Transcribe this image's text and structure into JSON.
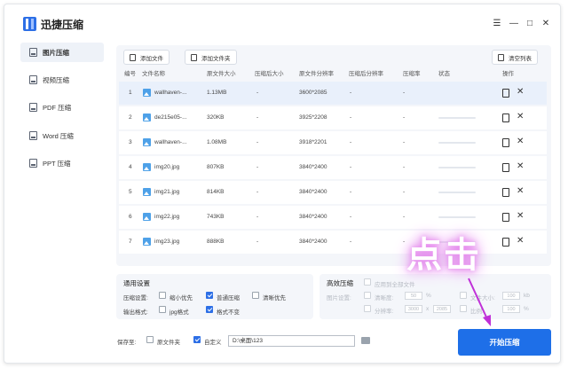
{
  "app": {
    "title": "迅捷压缩"
  },
  "window_controls": {
    "menu": "☰",
    "minimize": "—",
    "maximize": "□",
    "close": "✕"
  },
  "sidebar": {
    "items": [
      {
        "label": "图片压缩",
        "active": true
      },
      {
        "label": "视频压缩",
        "active": false
      },
      {
        "label": "PDF 压缩",
        "active": false
      },
      {
        "label": "Word 压缩",
        "active": false
      },
      {
        "label": "PPT 压缩",
        "active": false
      }
    ]
  },
  "toolbar": {
    "add_file": "添加文件",
    "add_folder": "添加文件夹",
    "clear_list": "清空列表"
  },
  "table": {
    "headers": [
      "编号",
      "文件名称",
      "原文件大小",
      "压缩后大小",
      "原文件分辨率",
      "压缩后分辨率",
      "压缩率",
      "状态",
      "操作"
    ],
    "rows": [
      {
        "num": "1",
        "name": "wallhaven-...",
        "size": "1.13MB",
        "csize": "-",
        "res": "3600*2085",
        "cres": "-",
        "rate": "-",
        "selected": true
      },
      {
        "num": "2",
        "name": "de215e05-...",
        "size": "320KB",
        "csize": "-",
        "res": "3925*2208",
        "cres": "-",
        "rate": "-",
        "selected": false
      },
      {
        "num": "3",
        "name": "wallhaven-...",
        "size": "1.08MB",
        "csize": "-",
        "res": "3918*2201",
        "cres": "-",
        "rate": "-",
        "selected": false
      },
      {
        "num": "4",
        "name": "img20.jpg",
        "size": "807KB",
        "csize": "-",
        "res": "3840*2400",
        "cres": "-",
        "rate": "-",
        "selected": false
      },
      {
        "num": "5",
        "name": "img21.jpg",
        "size": "814KB",
        "csize": "-",
        "res": "3840*2400",
        "cres": "-",
        "rate": "-",
        "selected": false
      },
      {
        "num": "6",
        "name": "img22.jpg",
        "size": "743KB",
        "csize": "-",
        "res": "3840*2400",
        "cres": "-",
        "rate": "-",
        "selected": false
      },
      {
        "num": "7",
        "name": "img23.jpg",
        "size": "888KB",
        "csize": "-",
        "res": "3840*2400",
        "cres": "-",
        "rate": "-",
        "selected": false
      }
    ]
  },
  "general_settings": {
    "title": "通用设置",
    "compress_label": "压缩设置:",
    "options": [
      {
        "label": "缩小优先",
        "checked": false
      },
      {
        "label": "普通压缩",
        "checked": true
      },
      {
        "label": "清晰优先",
        "checked": false
      }
    ],
    "format_label": "输出格式:",
    "formats": [
      {
        "label": "jpg格式",
        "checked": false
      },
      {
        "label": "格式不变",
        "checked": true
      }
    ]
  },
  "efficient_settings": {
    "title": "高效压缩",
    "apply_all": "应用到全部文件",
    "image_setting": "图片设置:",
    "clarity": "清晰度:",
    "clarity_value": "50",
    "percent": "%",
    "resolution": "分辨率:",
    "width_value": "3000",
    "times": "x",
    "height_value": "2085",
    "file_size": "文件大小:",
    "size_value": "100",
    "kb": "kb",
    "ratio": "比例:",
    "ratio_value": "100",
    "ratio_percent": "%"
  },
  "save": {
    "label": "保存至:",
    "original_folder": "原文件夹",
    "original_checked": false,
    "custom": "自定义",
    "custom_checked": true,
    "path": "D:\\桌面\\123"
  },
  "start_button": "开始压缩",
  "overlay": {
    "text": "点击"
  },
  "colors": {
    "accent": "#1e6fe8",
    "overlay_glow": "#d25fe0"
  }
}
